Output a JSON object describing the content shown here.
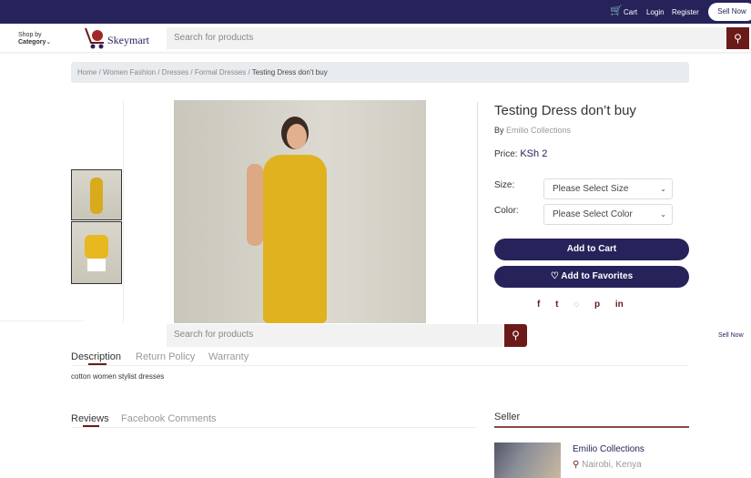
{
  "topbar": {
    "cart": "Cart",
    "login": "Login",
    "register": "Register",
    "sell_now": "Sell Now"
  },
  "header": {
    "shop_by": "Shop by",
    "category": "Category",
    "logo": "Skeymart",
    "search_placeholder": "Search for products"
  },
  "breadcrumb": [
    "Home",
    "Women Fashion",
    "Dresses",
    "Formal Dresses",
    "Testing Dress don't buy"
  ],
  "product": {
    "title": "Testing Dress don’t buy",
    "by": "By",
    "seller": "Emilio Collections",
    "price_label": "Price:",
    "price": "KSh 2",
    "size_label": "Size:",
    "size_value": "Please Select Size",
    "color_label": "Color:",
    "color_value": "Please Select Color",
    "add_to_cart": "Add to Cart",
    "add_to_favorites": "Add to Favorites"
  },
  "sticky": {
    "search_placeholder": "Search for products",
    "sell_now": "Sell Now"
  },
  "tabs": {
    "description": "Description",
    "return_policy": "Return Policy",
    "warranty": "Warranty",
    "description_text": "cotton women stylist dresses"
  },
  "reviews": {
    "reviews": "Reviews",
    "facebook": "Facebook Comments"
  },
  "seller_box": {
    "title": "Seller",
    "name": "Emilio Collections",
    "location": "Nairobi, Kenya"
  },
  "colors": {
    "navy": "#25235a",
    "maroon": "#6b1a1a"
  }
}
